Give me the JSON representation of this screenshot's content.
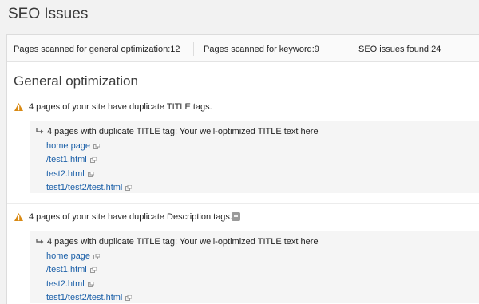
{
  "page": {
    "title": "SEO Issues"
  },
  "stats": {
    "general": "Pages scanned for general optimization:12",
    "keyword": "Pages scanned for keyword:9",
    "issues": "SEO issues found:24"
  },
  "section": {
    "title": "General optimization"
  },
  "issues": [
    {
      "text": "4 pages of your site have duplicate TITLE tags.",
      "detail": "4 pages with duplicate TITLE tag: Your well-optimized TITLE text here",
      "links": [
        "home page",
        "/test1.html",
        "test2.html",
        "test1/test2/test.html"
      ],
      "has_help_icon": false
    },
    {
      "text": "4 pages of your site have duplicate Description tags.",
      "detail": "4 pages with duplicate TITLE tag: Your well-optimized TITLE text here",
      "links": [
        "home page",
        "/test1.html",
        "test2.html",
        "test1/test2/test.html"
      ],
      "has_help_icon": true
    }
  ],
  "icons": {
    "warning": "warning-icon",
    "arrow": "sub-arrow-icon",
    "external": "external-link-icon",
    "help": "help-icon"
  },
  "colors": {
    "link": "#1a5fa8",
    "warning": "#d98a14",
    "background": "#f2f2f2"
  }
}
